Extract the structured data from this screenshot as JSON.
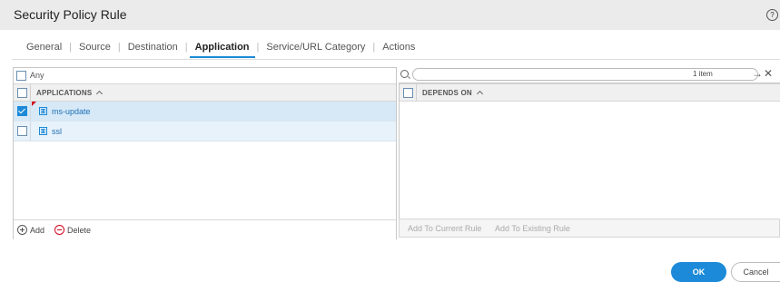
{
  "dialog": {
    "title": "Security Policy Rule",
    "help_glyph": "?"
  },
  "tabs": [
    {
      "label": "General"
    },
    {
      "label": "Source"
    },
    {
      "label": "Destination"
    },
    {
      "label": "Application",
      "active": true
    },
    {
      "label": "Service/URL Category"
    },
    {
      "label": "Actions"
    }
  ],
  "applications_panel": {
    "any_label": "Any",
    "any_checked": false,
    "column_header": "APPLICATIONS",
    "rows": [
      {
        "name": "ms-update",
        "checked": true,
        "selected": true
      },
      {
        "name": "ssl",
        "checked": false,
        "selected": false
      }
    ],
    "add_label": "Add",
    "delete_label": "Delete"
  },
  "depends_panel": {
    "search_value": "",
    "item_count": "1 item",
    "column_header": "DEPENDS ON",
    "add_to_current_label": "Add To Current Rule",
    "add_to_existing_label": "Add To Existing Rule"
  },
  "footer": {
    "ok_label": "OK",
    "cancel_label": "Cancel"
  },
  "colors": {
    "accent": "#1c8ad8",
    "delete_red": "#d0021b"
  }
}
